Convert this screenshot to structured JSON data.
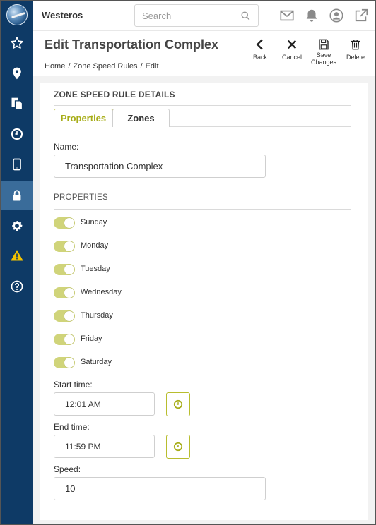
{
  "header": {
    "app_name": "Westeros",
    "search_placeholder": "Search"
  },
  "page": {
    "title": "Edit Transportation Complex",
    "breadcrumb": [
      "Home",
      "Zone Speed Rules",
      "Edit"
    ]
  },
  "actions": {
    "back": "Back",
    "cancel": "Cancel",
    "save_line1": "Save",
    "save_line2": "Changes",
    "delete": "Delete"
  },
  "card": {
    "section_title": "ZONE SPEED RULE DETAILS",
    "tabs": [
      "Properties",
      "Zones"
    ],
    "name_label": "Name:",
    "name_value": "Transportation Complex",
    "properties_label": "PROPERTIES",
    "days": [
      {
        "label": "Sunday",
        "on": true
      },
      {
        "label": "Monday",
        "on": true
      },
      {
        "label": "Tuesday",
        "on": true
      },
      {
        "label": "Wednesday",
        "on": true
      },
      {
        "label": "Thursday",
        "on": true
      },
      {
        "label": "Friday",
        "on": true
      },
      {
        "label": "Saturday",
        "on": true
      }
    ],
    "start_time_label": "Start time:",
    "start_time_value": "12:01 AM",
    "end_time_label": "End time:",
    "end_time_value": "11:59 PM",
    "speed_label": "Speed:",
    "speed_value": "10"
  },
  "colors": {
    "sidebar": "#0e3a66",
    "sidebar_active": "#3a6c9a",
    "accent": "#a7ad18",
    "toggle_on": "#d0d47a",
    "warning": "#f2c200"
  },
  "sidebar_icons": [
    "star-icon",
    "map-pin-icon",
    "documents-icon",
    "clock-icon",
    "tablet-icon",
    "lock-icon",
    "gear-icon",
    "warning-icon",
    "help-icon"
  ]
}
